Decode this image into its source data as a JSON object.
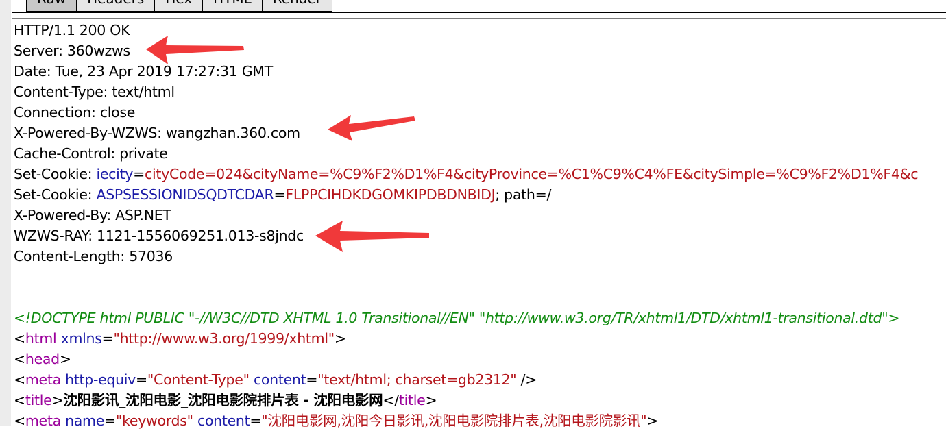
{
  "tabs": [
    {
      "label": "Raw",
      "active": true
    },
    {
      "label": "Headers",
      "active": false
    },
    {
      "label": "Hex",
      "active": false
    },
    {
      "label": "HTML",
      "active": false
    },
    {
      "label": "Render",
      "active": false
    }
  ],
  "headers": {
    "status": "HTTP/1.1 200 OK",
    "server": "Server: 360wzws",
    "date": "Date: Tue, 23 Apr 2019 17:27:31 GMT",
    "content_type": "Content-Type: text/html",
    "connection": "Connection: close",
    "x_powered_by_wzws": "X-Powered-By-WZWS: wangzhan.360.com",
    "cache_control": "Cache-Control: private",
    "cookie1": {
      "prefix": "Set-Cookie: ",
      "name": "iecity",
      "eq": "=",
      "value": "cityCode=024&cityName=%C9%F2%D1%F4&cityProvince=%C1%C9%C4%FE&citySimple=%C9%F2%D1%F4&c"
    },
    "cookie2": {
      "prefix": "Set-Cookie: ",
      "name": "ASPSESSIONIDSQDTCDAR",
      "eq": "=",
      "value": "FLPPCIHDKDGOMKIPDBDNBIDJ",
      "suffix": "; path=/"
    },
    "x_powered_by": "X-Powered-By: ASP.NET",
    "wzws_ray": "WZWS-RAY: 1121-1556069251.013-s8jndc",
    "content_length": "Content-Length: 57036"
  },
  "body": {
    "doctype": "<!DOCTYPE html PUBLIC \"-//W3C//DTD XHTML 1.0 Transitional//EN\" \"http://www.w3.org/TR/xhtml1/DTD/xhtml1-transitional.dtd\">",
    "html_tag": "html",
    "html_attr": "xmlns",
    "html_attr_value": "\"http://www.w3.org/1999/xhtml\"",
    "head_tag": "head",
    "meta_tag": "meta",
    "meta1_attr1": "http-equiv",
    "meta1_val1": "\"Content-Type\"",
    "meta1_attr2": "content",
    "meta1_val2": "\"text/html; charset=gb2312\"",
    "title_tag": "title",
    "title_text": "沈阳影讯_沈阳电影_沈阳电影院排片表 - 沈阳电影网",
    "meta2_attr1": "name",
    "meta2_val1": "\"keywords\"",
    "meta2_attr2": "content",
    "meta2_val2": "\"沈阳电影网,沈阳今日影讯,沈阳电影院排片表,沈阳电影院影讯\""
  },
  "colors": {
    "arrow": "#f0393a",
    "attr_name": "#1c1ca8",
    "attr_value": "#b4151b",
    "tag": "#9b009b",
    "comment": "#128c12"
  }
}
